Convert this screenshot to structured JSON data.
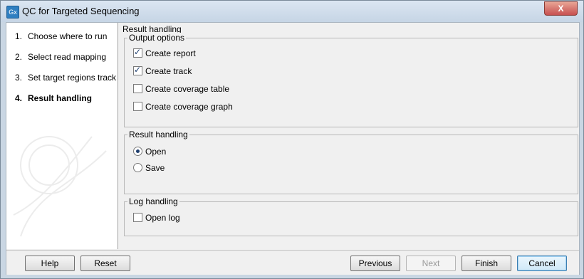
{
  "window": {
    "title": "QC for Targeted Sequencing",
    "icon": "Gx",
    "close_label": "X"
  },
  "steps": [
    {
      "num": "1.",
      "label": "Choose where to run",
      "active": false
    },
    {
      "num": "2.",
      "label": "Select read mapping",
      "active": false
    },
    {
      "num": "3.",
      "label": "Set target regions track",
      "active": false
    },
    {
      "num": "4.",
      "label": "Result handling",
      "active": true
    }
  ],
  "content": {
    "section_title": "Result handling",
    "output_options": {
      "title": "Output options",
      "items": [
        {
          "label": "Create report",
          "checked": true
        },
        {
          "label": "Create track",
          "checked": true
        },
        {
          "label": "Create coverage table",
          "checked": false
        },
        {
          "label": "Create coverage graph",
          "checked": false
        }
      ]
    },
    "result_handling": {
      "title": "Result handling",
      "options": [
        {
          "label": "Open",
          "selected": true
        },
        {
          "label": "Save",
          "selected": false
        }
      ]
    },
    "log_handling": {
      "title": "Log handling",
      "items": [
        {
          "label": "Open log",
          "checked": false
        }
      ]
    }
  },
  "buttons": {
    "help": "Help",
    "reset": "Reset",
    "previous": "Previous",
    "next": "Next",
    "finish": "Finish",
    "cancel": "Cancel"
  }
}
